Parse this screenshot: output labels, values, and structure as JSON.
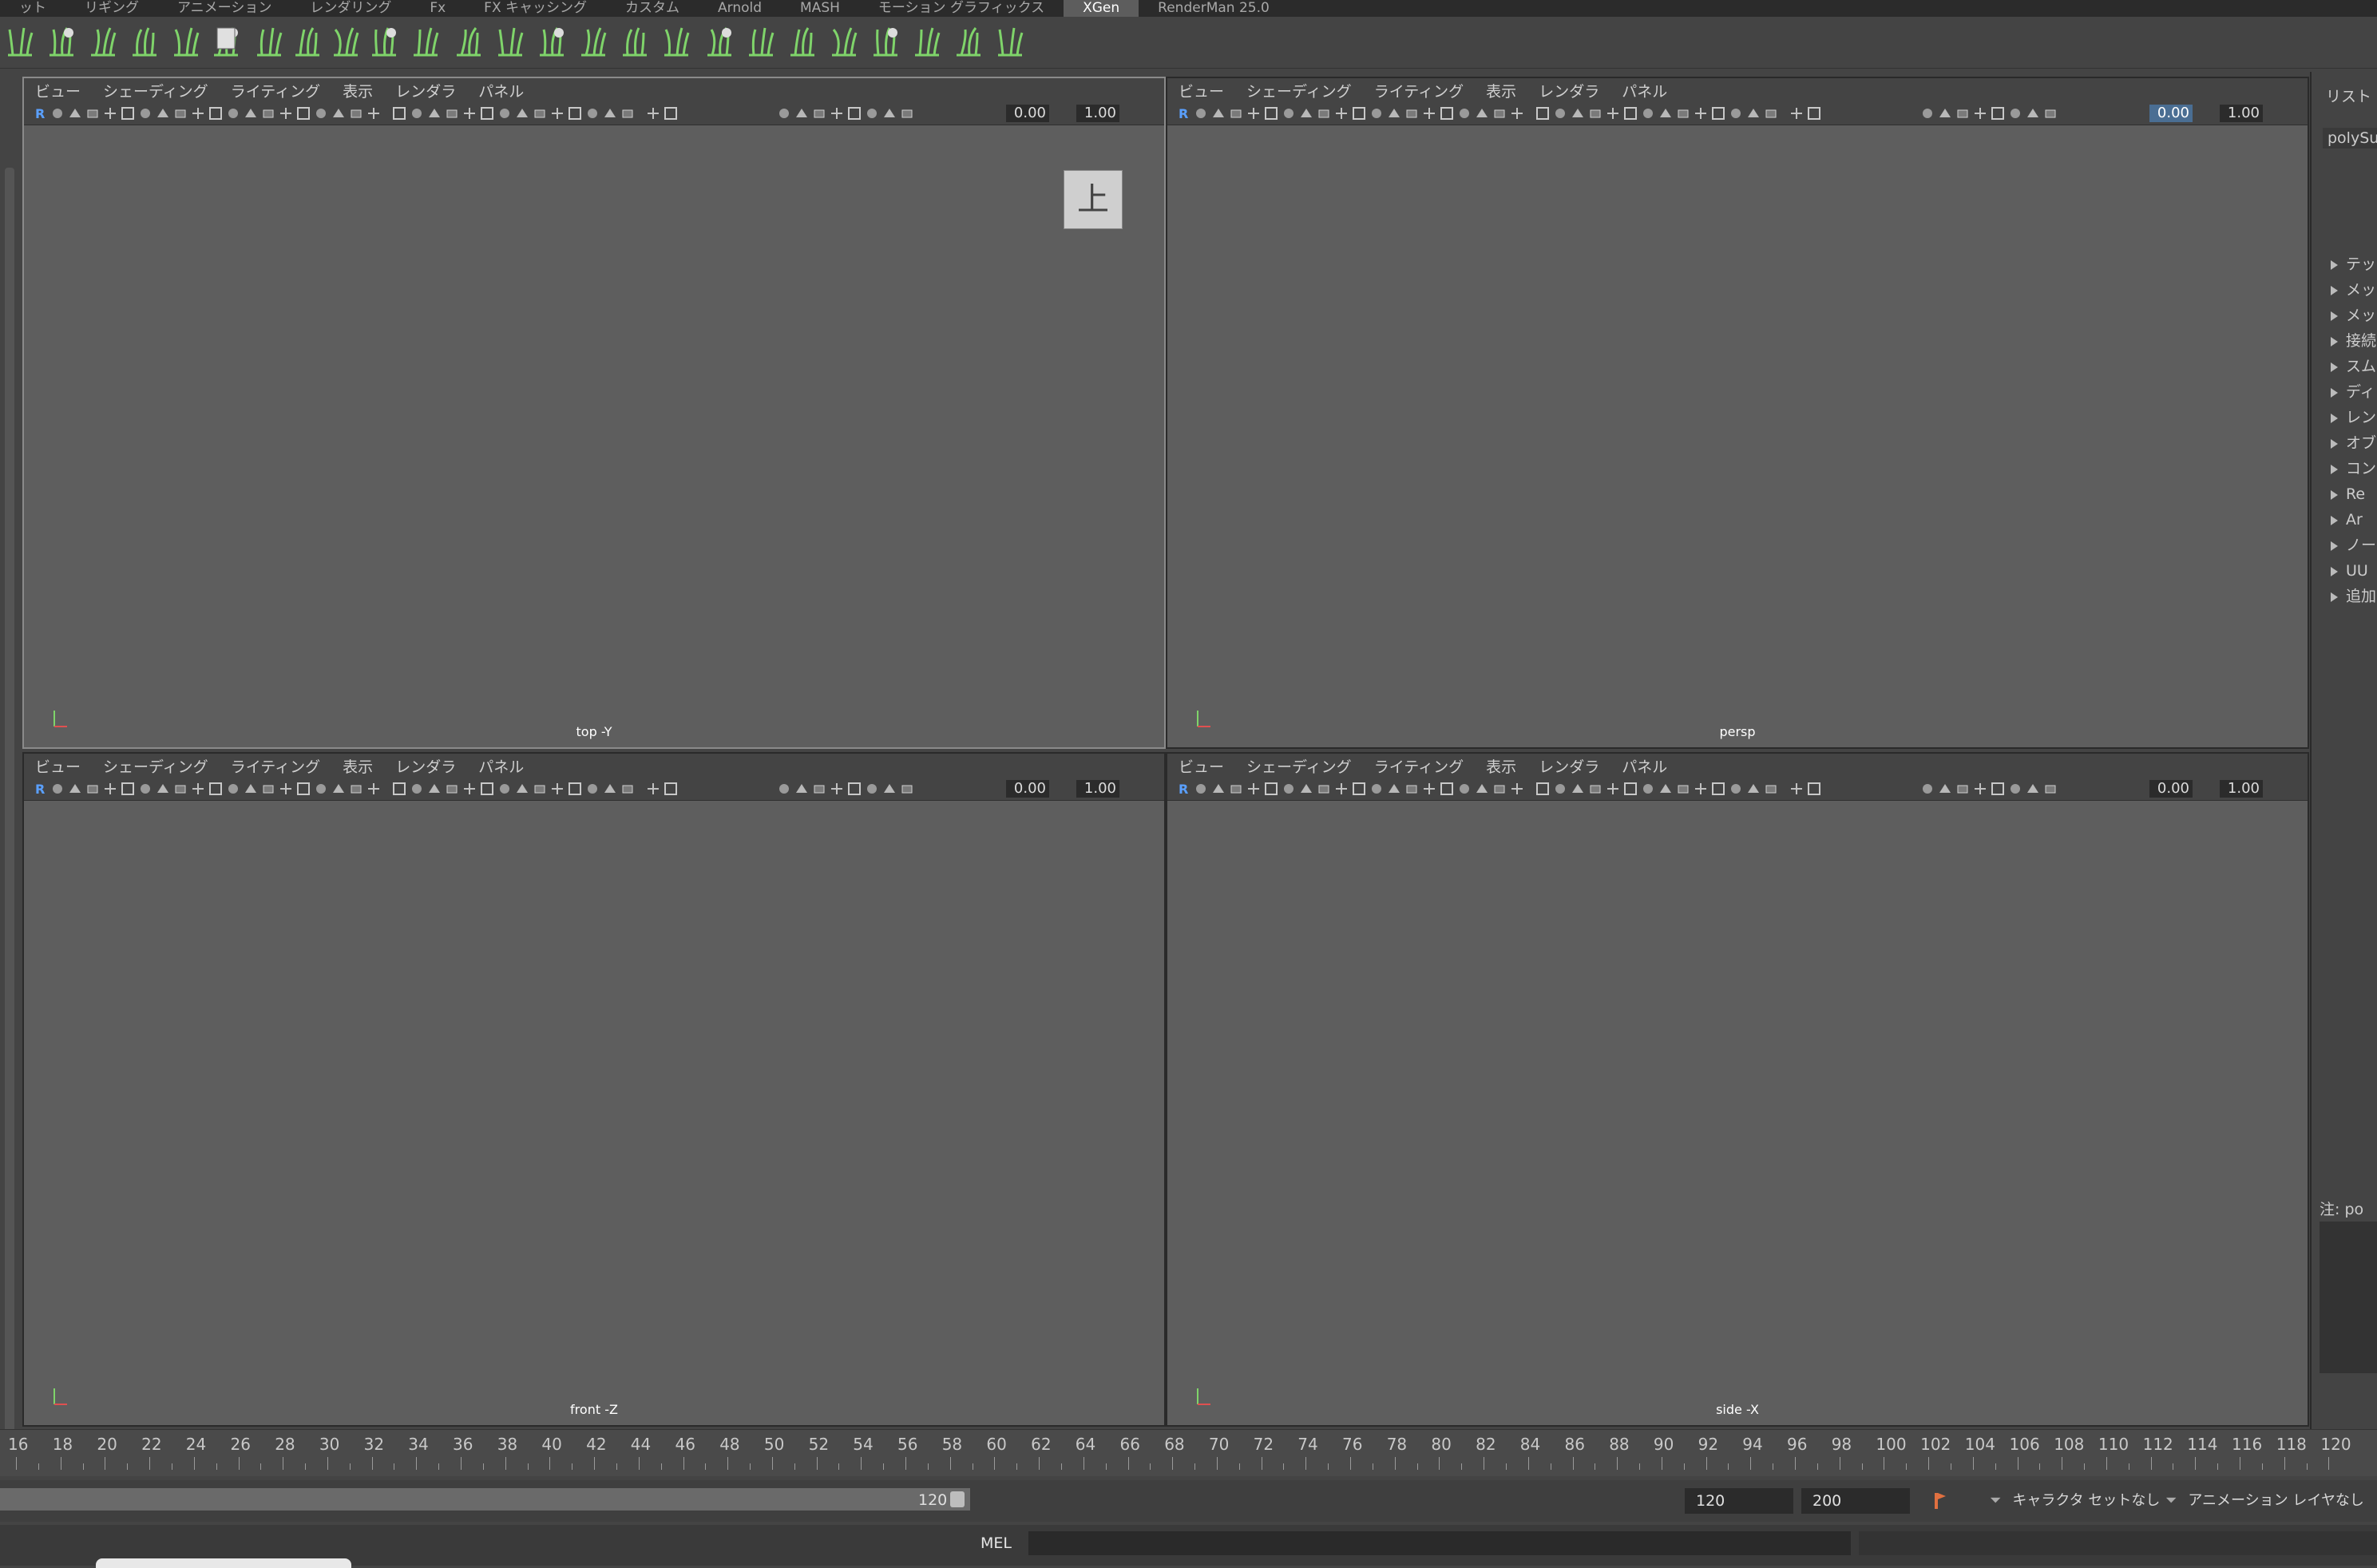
{
  "shelf_tabs": [
    "ット",
    "リギング",
    "アニメーション",
    "レンダリング",
    "Fx",
    "FX キャッシング",
    "カスタム",
    "Arnold",
    "MASH",
    "モーション グラフィックス",
    "XGen",
    "RenderMan 25.0"
  ],
  "active_shelf_tab": "XGen",
  "viewport_menu": [
    "ビュー",
    "シェーディング",
    "ライティング",
    "表示",
    "レンダラ",
    "パネル"
  ],
  "viewports": {
    "top": {
      "camera": "top -Y",
      "exposure": "0.00",
      "gamma": "1.00",
      "view_cube_label": "上"
    },
    "persp": {
      "camera": "persp",
      "exposure": "0.00",
      "gamma": "1.00"
    },
    "front": {
      "camera": "front -Z",
      "exposure": "0.00",
      "gamma": "1.00"
    },
    "side": {
      "camera": "side -X",
      "exposure": "0.00",
      "gamma": "1.00"
    }
  },
  "right_panel": {
    "title": "リスト",
    "node": "polySu",
    "sections": [
      "テッ",
      "メッ",
      "メッ",
      "接続",
      "スム",
      "ディ",
      "レン",
      "オブ",
      "コン",
      "Re",
      "Ar",
      "ノー",
      "UU",
      "追加"
    ],
    "note": "注:  po"
  },
  "timeline": {
    "ticks": [
      "16",
      "18",
      "20",
      "22",
      "24",
      "26",
      "28",
      "30",
      "32",
      "34",
      "36",
      "38",
      "40",
      "42",
      "44",
      "46",
      "48",
      "50",
      "52",
      "54",
      "56",
      "58",
      "60",
      "62",
      "64",
      "66",
      "68",
      "70",
      "72",
      "74",
      "76",
      "78",
      "80",
      "82",
      "84",
      "86",
      "88",
      "90",
      "92",
      "94",
      "96",
      "98",
      "100",
      "102",
      "104",
      "106",
      "108",
      "110",
      "112",
      "114",
      "116",
      "118",
      "120"
    ]
  },
  "range": {
    "range_end": "120",
    "end_time": "120",
    "total_end": "200",
    "character_set": "キャラクタ セットなし",
    "anim_layer": "アニメーション レイヤなし"
  },
  "command_line": {
    "language": "MEL"
  },
  "colors": {
    "wireframe": "#4ee6a8",
    "viewport_bg": "#5e5e5e",
    "active_tab": "#5d5d5d"
  }
}
